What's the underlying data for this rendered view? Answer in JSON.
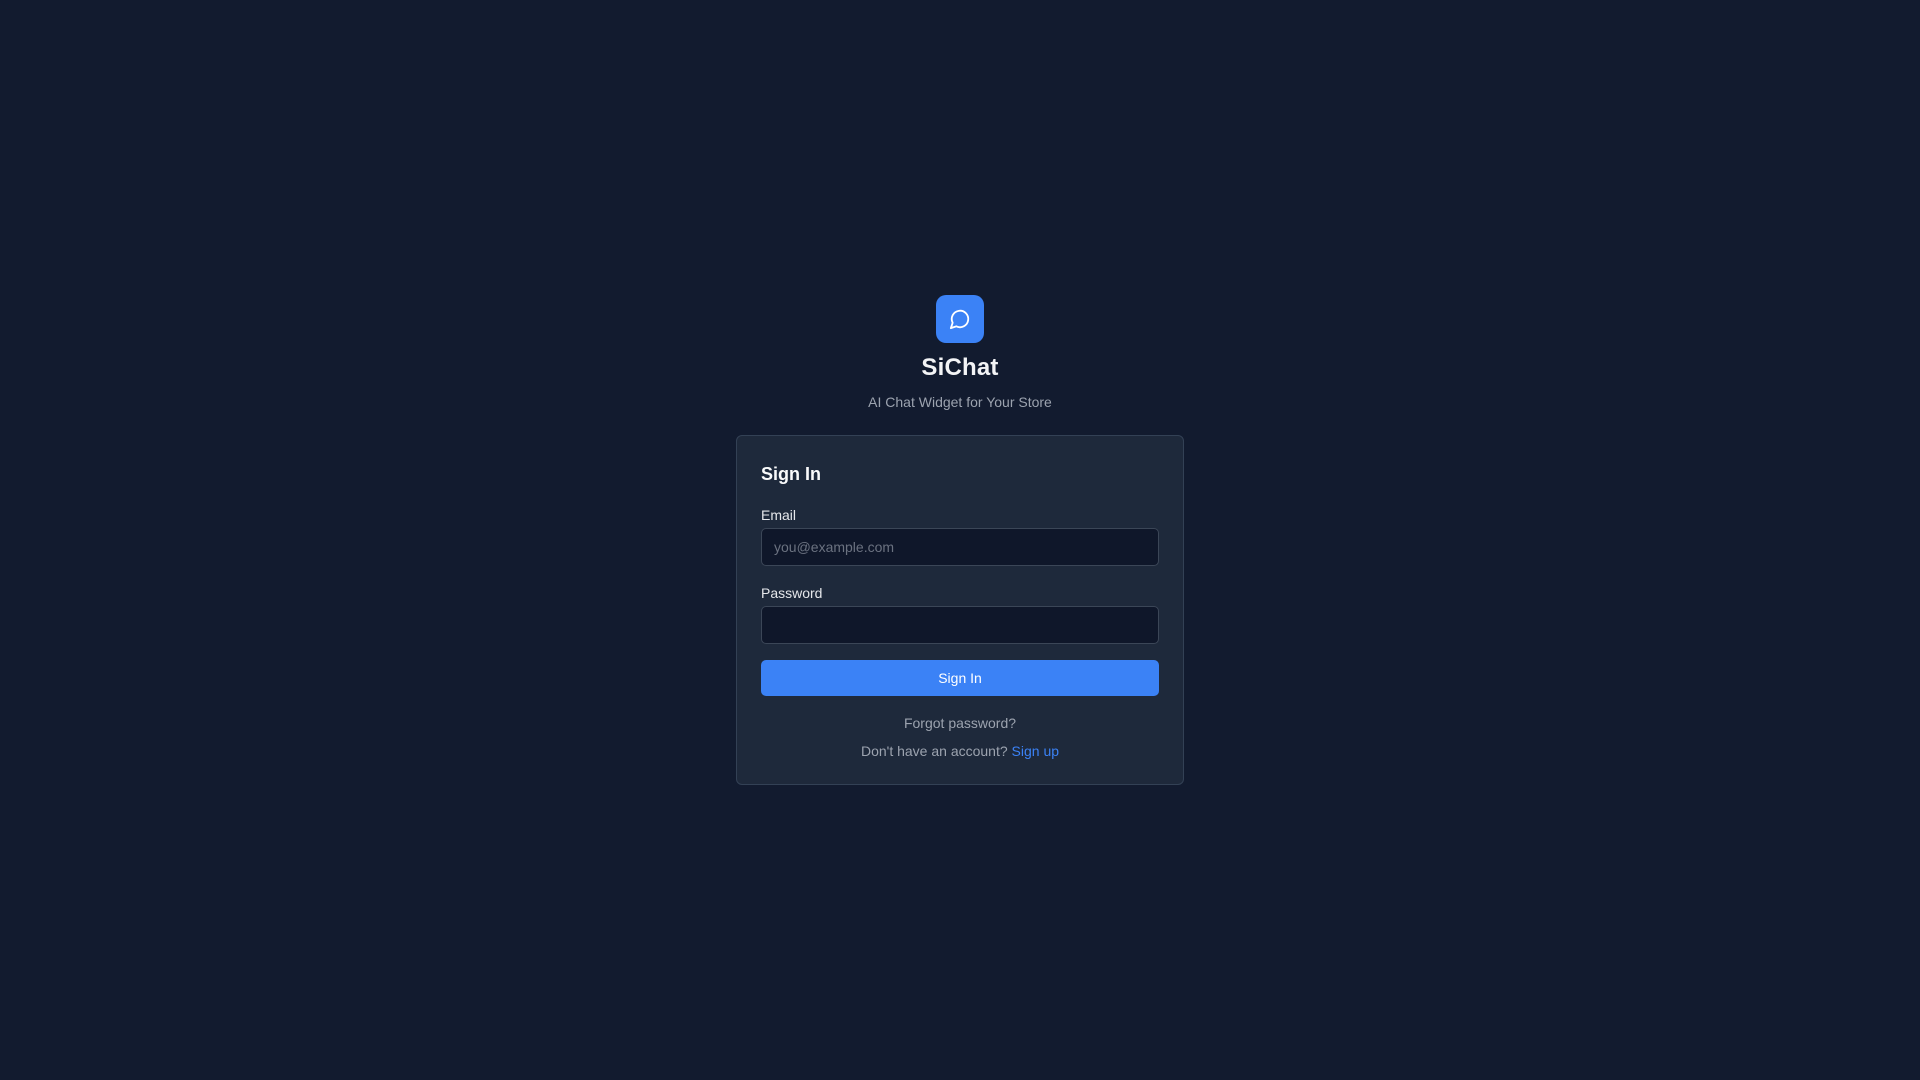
{
  "brand": {
    "logo_icon": "chat-bubble-icon",
    "app_name": "SiChat",
    "tagline": "AI Chat Widget for Your Store"
  },
  "signin_card": {
    "title": "Sign In",
    "email": {
      "label": "Email",
      "value": "",
      "placeholder": "you@example.com"
    },
    "password": {
      "label": "Password",
      "value": "",
      "placeholder": ""
    },
    "submit_label": "Sign In",
    "forgot_label": "Forgot password?",
    "signup_prompt": "Don't have an account?",
    "signup_link": "Sign up"
  },
  "colors": {
    "background": "#121b2f",
    "card": "#1e293b",
    "accent": "#3b82f6",
    "input_bg": "#0f172a",
    "muted_text": "#9ca3af"
  }
}
